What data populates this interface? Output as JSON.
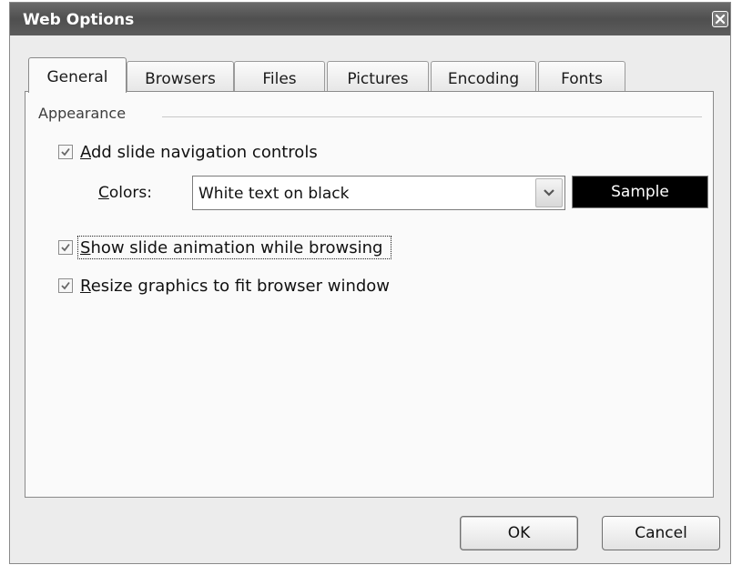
{
  "window": {
    "title": "Web Options"
  },
  "tabs": [
    {
      "label": "General",
      "active": true
    },
    {
      "label": "Browsers",
      "active": false
    },
    {
      "label": "Files",
      "active": false
    },
    {
      "label": "Pictures",
      "active": false
    },
    {
      "label": "Encoding",
      "active": false
    },
    {
      "label": "Fonts",
      "active": false
    }
  ],
  "appearance": {
    "group_label": "Appearance",
    "add_nav_controls": {
      "label_mnemonic": "A",
      "label_rest": "dd slide navigation controls",
      "checked": true
    },
    "colors": {
      "label_mnemonic": "C",
      "label_rest": "olors:",
      "selected": "White text on black"
    },
    "sample": {
      "label": "Sample"
    },
    "show_animation": {
      "label_mnemonic": "S",
      "label_rest": "how slide animation while browsing",
      "checked": true
    },
    "resize_graphics": {
      "label_mnemonic": "R",
      "label_rest": "esize graphics to fit browser window",
      "checked": true
    }
  },
  "buttons": {
    "ok": "OK",
    "cancel": "Cancel"
  },
  "colors": {
    "titlebar": "#555555",
    "dialog_bg": "#ececec",
    "sample_bg": "#000000",
    "sample_fg": "#ffffff"
  }
}
